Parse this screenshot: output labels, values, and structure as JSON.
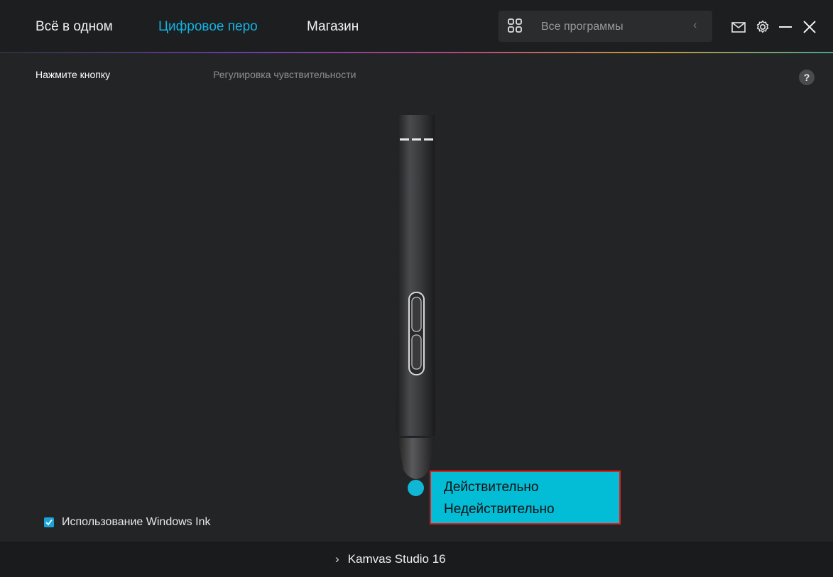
{
  "header": {
    "tabs": [
      {
        "label": "Всё в одном",
        "active": false
      },
      {
        "label": "Цифровое перо",
        "active": true
      },
      {
        "label": "Магазин",
        "active": false
      }
    ],
    "app_search": {
      "placeholder": "Все программы",
      "icon": "apps-grid-icon"
    },
    "window_icons": [
      "mail-icon",
      "gear-icon",
      "minimize-icon",
      "close-icon"
    ]
  },
  "subtabs": [
    {
      "label": "Нажмите кнопку",
      "active": true
    },
    {
      "label": "Регулировка чувствительности",
      "active": false
    }
  ],
  "help_label": "?",
  "pen_tip_popup": {
    "options": [
      "Действительно",
      "Недействительно"
    ]
  },
  "windows_ink": {
    "label": "Использование Windows Ink",
    "checked": true
  },
  "footer": {
    "device": "Kamvas Studio 16"
  },
  "colors": {
    "accent": "#11b3e3",
    "popup_bg": "#03bcd6",
    "popup_border": "#e01e1e",
    "background": "#232426"
  }
}
